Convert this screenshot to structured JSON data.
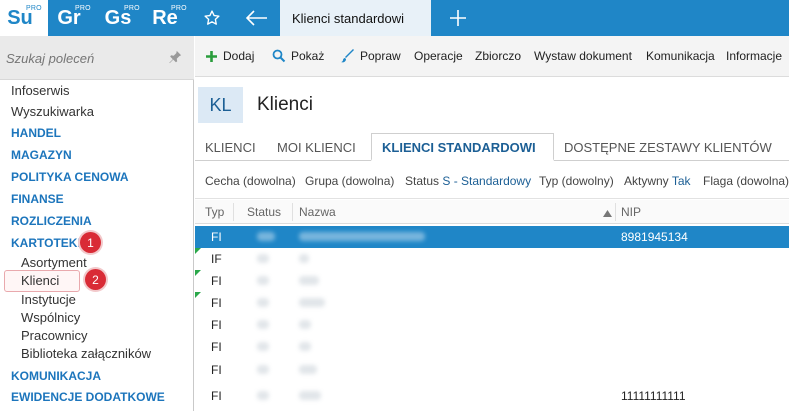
{
  "appbar": {
    "apps": [
      {
        "code": "Su",
        "badge": "PRO",
        "active": true
      },
      {
        "code": "Gr",
        "badge": "PRO",
        "active": false
      },
      {
        "code": "Gs",
        "badge": "PRO",
        "active": false
      },
      {
        "code": "Re",
        "badge": "PRO",
        "active": false
      }
    ],
    "icons": [
      "star-icon",
      "back-arrow-icon",
      "plus-icon"
    ],
    "active_tab": "Klienci standardowi"
  },
  "sidebar": {
    "search_placeholder": "Szukaj poleceń",
    "items": [
      {
        "label": "Infoserwis",
        "type": "link"
      },
      {
        "label": "Wyszukiwarka",
        "type": "link"
      },
      {
        "label": "HANDEL",
        "type": "section"
      },
      {
        "label": "MAGAZYN",
        "type": "section"
      },
      {
        "label": "POLITYKA CENOWA",
        "type": "section"
      },
      {
        "label": "FINANSE",
        "type": "section"
      },
      {
        "label": "ROZLICZENIA",
        "type": "section"
      },
      {
        "label": "KARTOTEKI",
        "type": "section"
      },
      {
        "label": "KOMUNIKACJA",
        "type": "section"
      },
      {
        "label": "EWIDENCJE DODATKOWE",
        "type": "section"
      }
    ],
    "subitems": [
      "Asortyment",
      "Klienci",
      "Instytucje",
      "Wspólnicy",
      "Pracownicy",
      "Biblioteka załączników"
    ],
    "badges": [
      "1",
      "2"
    ]
  },
  "toolbar": {
    "add": "Dodaj",
    "show": "Pokaż",
    "edit": "Popraw",
    "operations": "Operacje",
    "bulk": "Zbiorczo",
    "issue_doc": "Wystaw dokument",
    "communication": "Komunikacja",
    "info": "Informacje"
  },
  "header": {
    "badge": "KL",
    "title": "Klienci"
  },
  "tabs": [
    "KLIENCI",
    "MOI KLIENCI",
    "KLIENCI STANDARDOWI",
    "DOSTĘPNE ZESTAWY KLIENTÓW"
  ],
  "filters": {
    "feature": "Cecha (dowolna)",
    "group": "Grupa (dowolna)",
    "status_label": "Status",
    "status_value": "S - Standardowy",
    "type": "Typ (dowolny)",
    "active_label": "Aktywny",
    "active_value": "Tak",
    "flag": "Flaga (dowolna)"
  },
  "grid": {
    "columns": [
      "Typ",
      "Status",
      "Nazwa",
      "NIP"
    ],
    "sorted_column": "Nazwa",
    "rows": [
      {
        "typ": "FI",
        "nip": "8981945134",
        "selected": true,
        "marker": false
      },
      {
        "typ": "IF",
        "nip": "",
        "selected": false,
        "marker": true
      },
      {
        "typ": "FI",
        "nip": "",
        "selected": false,
        "marker": true
      },
      {
        "typ": "FI",
        "nip": "",
        "selected": false,
        "marker": true
      },
      {
        "typ": "FI",
        "nip": "",
        "selected": false,
        "marker": false
      },
      {
        "typ": "FI",
        "nip": "",
        "selected": false,
        "marker": false
      },
      {
        "typ": "FI",
        "nip": "",
        "selected": false,
        "marker": false
      },
      {
        "typ": "FI",
        "nip": "11111111111",
        "selected": false,
        "marker": false
      }
    ]
  },
  "colors": {
    "brand": "#1f86c7",
    "section": "#1c75bc",
    "badge": "#d92b36",
    "selected_row": "#1f86c7"
  }
}
